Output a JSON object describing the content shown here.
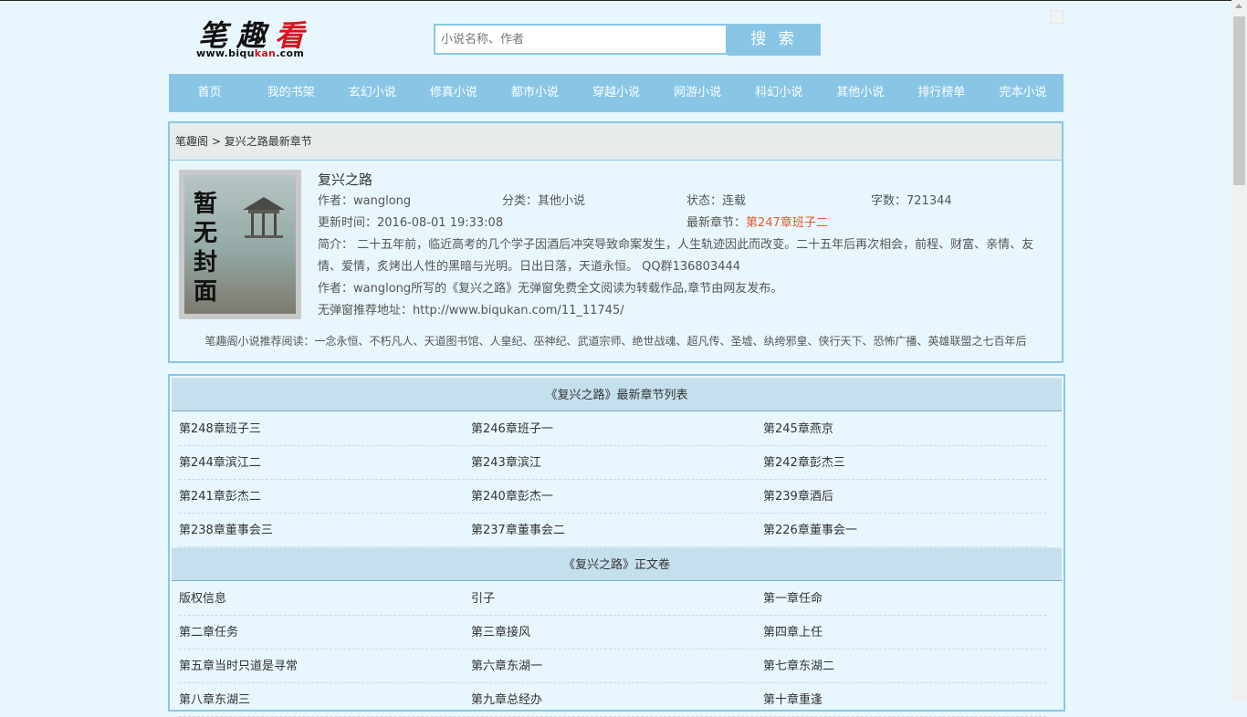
{
  "logo": {
    "title_a": "笔趣",
    "title_b": "看",
    "url_a": "www.biqu",
    "url_b": "kan",
    "url_c": ".com"
  },
  "search": {
    "placeholder": "小说名称、作者",
    "button": "搜 索"
  },
  "nav": [
    "首页",
    "我的书架",
    "玄幻小说",
    "修真小说",
    "都市小说",
    "穿越小说",
    "网游小说",
    "科幻小说",
    "其他小说",
    "排行榜单",
    "完本小说"
  ],
  "breadcrumb": {
    "home": "笔趣阁",
    "sep": " > ",
    "current": "复兴之路最新章节"
  },
  "book": {
    "cover_text": "暂无封面",
    "title": "复兴之路",
    "author_label": "作者：",
    "author": "wanglong",
    "category_label": "分类：",
    "category": "其他小说",
    "status_label": "状态：",
    "status": "连载",
    "words_label": "字数：",
    "words": "721344",
    "updated_label": "更新时间：",
    "updated": "2016-08-01 19:33:08",
    "latest_label": "最新章节：",
    "latest": "第247章班子二",
    "intro": "简介：  二十五年前，临近高考的几个学子因酒后冲突导致命案发生，人生轨迹因此而改变。二十五年后再次相会，前程、财富、亲情、友情、爱情，炙烤出人性的黑暗与光明。日出日落，天道永恒。  QQ群136803444",
    "author_note": "作者：wanglong所写的《复兴之路》无弹窗免费全文阅读为转载作品,章节由网友发布。",
    "recommend_addr_label": "无弹窗推荐地址：",
    "recommend_addr": "http://www.biqukan.com/11_11745/"
  },
  "recommend_line": "笔趣阁小说推荐阅读：一念永恒、不朽凡人、天道图书馆、人皇纪、巫神纪、武道宗师、绝世战魂、超凡传、圣墟、纨绔邪皇、侠行天下、恐怖广播、英雄联盟之七百年后",
  "latest_section": {
    "title": "《复兴之路》最新章节列表",
    "rows": [
      [
        "第248章班子三",
        "第246章班子一",
        "第245章燕京"
      ],
      [
        "第244章滨江二",
        "第243章滨江",
        "第242章彭杰三"
      ],
      [
        "第241章彭杰二",
        "第240章彭杰一",
        "第239章酒后"
      ],
      [
        "第238章董事会三",
        "第237章董事会二",
        "第226章董事会一"
      ]
    ]
  },
  "main_section": {
    "title": "《复兴之路》正文卷",
    "rows": [
      [
        "版权信息",
        "引子",
        "第一章任命"
      ],
      [
        "第二章任务",
        "第三章接风",
        "第四章上任"
      ],
      [
        "第五章当时只道是寻常",
        "第六章东湖一",
        "第七章东湖二"
      ],
      [
        "第八章东湖三",
        "第九章总经办",
        "第十章重逢"
      ]
    ]
  }
}
